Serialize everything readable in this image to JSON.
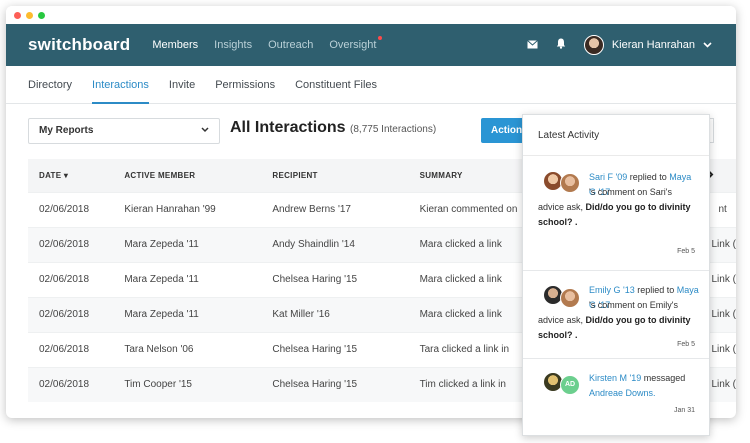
{
  "app": {
    "logo": "switchboard"
  },
  "topnav": {
    "items": [
      "Members",
      "Insights",
      "Outreach",
      "Oversight"
    ],
    "user_name": "Kieran Hanrahan",
    "icons": [
      "mail-icon",
      "bell-icon",
      "chevron-down-icon"
    ]
  },
  "subnav": {
    "tabs": [
      "Directory",
      "Interactions",
      "Invite",
      "Permissions",
      "Constituent Files"
    ]
  },
  "toolbar": {
    "report_select": "My Reports",
    "heading": "All Interactions",
    "count": "(8,775 Interactions)",
    "action_label": "Actions"
  },
  "table": {
    "headers": [
      "DATE",
      "ACTIVE MEMBER",
      "RECIPIENT",
      "SUMMARY"
    ],
    "rows": [
      [
        "02/06/2018",
        "Kieran Hanrahan '99",
        "Andrew Berns '17",
        "Kieran commented on"
      ],
      [
        "02/06/2018",
        "Mara Zepeda '11",
        "Andy Shaindlin '14",
        "Mara clicked a link"
      ],
      [
        "02/06/2018",
        "Mara Zepeda '11",
        "Chelsea Haring '15",
        "Mara clicked a link"
      ],
      [
        "02/06/2018",
        "Mara Zepeda '11",
        "Kat Miller '16",
        "Mara clicked a link"
      ],
      [
        "02/06/2018",
        "Tara Nelson '06",
        "Chelsea Haring '15",
        "Tara clicked a link in"
      ],
      [
        "02/06/2018",
        "Tim Cooper '15",
        "Chelsea Haring '15",
        "Tim clicked a link in"
      ]
    ],
    "overflow_texts": [
      "nt",
      "Link (",
      "Link (",
      "Link (",
      "Link (",
      "Link ("
    ]
  },
  "activity": {
    "title": "Latest Activity",
    "items": [
      {
        "actor": "Sari F '09",
        "verb": " replied to ",
        "target": "Maya G '17",
        "rest": "'s comment on Sari's advice ask, ",
        "quote": "Did/do you go to divinity school? .",
        "date": "Feb 5"
      },
      {
        "actor": "Emily G '13",
        "verb": " replied to ",
        "target": "Maya G '17",
        "rest": "'s comment on Emily's advice ask, ",
        "quote": "Did/do you go to divinity school? .",
        "date": "Feb 5"
      },
      {
        "actor": "Kirsten M '19",
        "verb": " messaged ",
        "target": "Andreae Downs.",
        "date": "Jan 31",
        "badge": "AD"
      }
    ]
  }
}
